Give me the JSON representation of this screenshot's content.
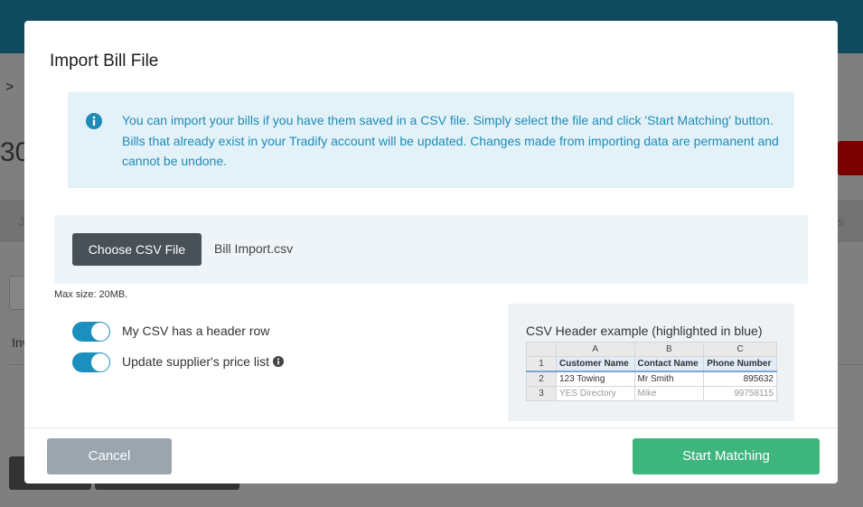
{
  "background": {
    "chevron": ">",
    "partial_number": "30",
    "band_left_fragment": "J",
    "band_right_fragment": "s",
    "partial_label": "Inv"
  },
  "modal": {
    "title": "Import Bill File",
    "info": {
      "icon": "info-circle-icon",
      "text": "You can import your bills if you have them saved in a CSV file. Simply select the file and click 'Start Matching' button. Bills that already exist in your Tradify account will be updated. Changes made from importing data are permanent and cannot be undone."
    },
    "file": {
      "choose_label": "Choose CSV File",
      "selected_file": "Bill Import.csv",
      "max_size": "Max size: 20MB."
    },
    "toggles": [
      {
        "label": "My CSV has a header row",
        "on": true
      },
      {
        "label": "Update supplier's price list",
        "on": true,
        "info_icon": "info-circle-icon"
      }
    ],
    "example": {
      "title": "CSV Header example (highlighted in blue)",
      "columns": [
        "A",
        "B",
        "C"
      ],
      "rows": [
        {
          "n": "1",
          "cells": [
            "Customer Name",
            "Contact Name",
            "Phone Number"
          ]
        },
        {
          "n": "2",
          "cells": [
            "123 Towing",
            "Mr Smith",
            "895632"
          ]
        },
        {
          "n": "3",
          "cells": [
            "YES Directory",
            "Mike",
            "99758115"
          ]
        }
      ]
    },
    "footer": {
      "cancel_label": "Cancel",
      "start_label": "Start Matching"
    }
  },
  "colors": {
    "topbar": "#0f4a5e",
    "info_text": "#1e8bb7",
    "info_bg": "#e3f2f8",
    "toggle_on": "#1b8fbe",
    "start_button": "#3db57d",
    "cancel_button": "#9aa5ae",
    "choose_button": "#475157"
  }
}
